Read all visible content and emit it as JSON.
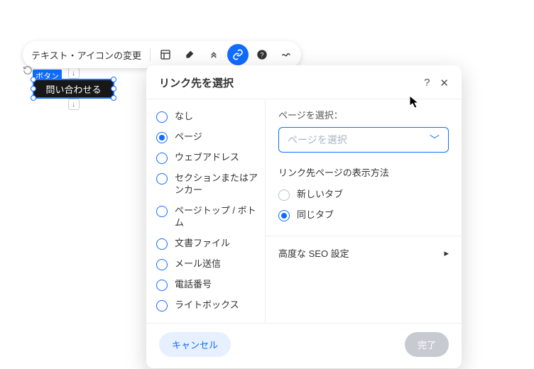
{
  "toolbar": {
    "label": "テキスト・アイコンの変更"
  },
  "canvas": {
    "element_tag": "ボタン",
    "button_text": "問い合わせる"
  },
  "modal": {
    "title": "リンク先を選択",
    "link_types": {
      "0": "なし",
      "1": "ページ",
      "2": "ウェブアドレス",
      "3": "セクションまたはアンカー",
      "4": "ページトップ / ボトム",
      "5": "文書ファイル",
      "6": "メール送信",
      "7": "電話番号",
      "8": "ライトボックス"
    },
    "page_select_label": "ページを選択：",
    "page_select_placeholder": "ページを選択",
    "open_mode_label": "リンク先ページの表示方法",
    "open_modes": {
      "0": "新しいタブ",
      "1": "同じタブ"
    },
    "seo_label": "高度な SEO 設定",
    "cancel": "キャンセル",
    "done": "完了"
  }
}
